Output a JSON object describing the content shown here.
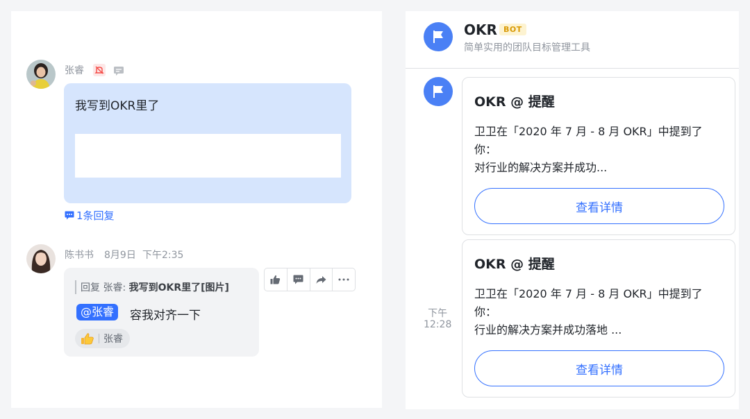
{
  "chat": {
    "message1": {
      "sender": "张睿",
      "text": "我写到OKR里了",
      "reply_count": "1条回复"
    },
    "message2": {
      "sender": "陈书书",
      "date": "8月9日",
      "time": "下午2:35",
      "quote_prefix": "回复 张睿: ",
      "quote_content": "我写到OKR里了[图片]",
      "mention": "@张睿",
      "text": "容我对齐一下",
      "reaction_user": "张睿"
    },
    "actions": [
      "thumbs-up-icon",
      "comment-icon",
      "share-icon",
      "more-icon"
    ]
  },
  "bot": {
    "name": "OKR",
    "badge": "BOT",
    "description": "简单实用的团队目标管理工具",
    "time": "下午 12:28",
    "time_line1": "下午",
    "time_line2": "12:28",
    "cards": [
      {
        "title": "OKR @ 提醒",
        "line1": "卫卫在「2020 年 7 月 - 8 月 OKR」中提到了",
        "line2": "你：",
        "line3": "对行业的解决方案并成功...",
        "button": "查看详情"
      },
      {
        "title": "OKR @ 提醒",
        "line1": "卫卫在「2020 年 7 月 - 8 月 OKR」中提到了",
        "line2": "你：",
        "line3": "行业的解决方案并成功落地 ...",
        "button": "查看详情"
      }
    ]
  },
  "colors": {
    "accent": "#3370ff",
    "bubble_blue": "#d6e5fd",
    "bubble_grey": "#f2f3f5",
    "bot_avatar": "#4a80f5",
    "badge": "#d99a06"
  }
}
